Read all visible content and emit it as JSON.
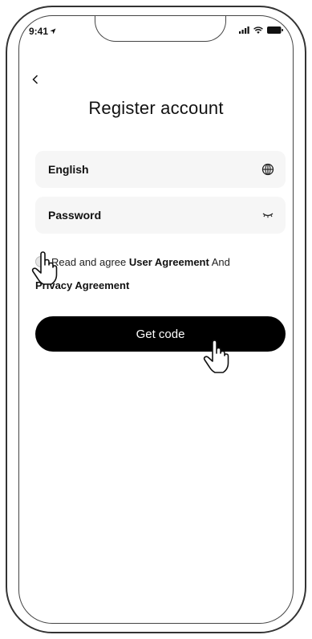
{
  "status_bar": {
    "time": "9:41",
    "icons": [
      "location-arrow-icon",
      "signal-icon",
      "wifi-icon",
      "battery-icon"
    ]
  },
  "header": {
    "back_icon": "chevron-left-icon",
    "title": "Register account"
  },
  "form": {
    "language_field": {
      "value": "English",
      "icon": "globe-icon"
    },
    "password_field": {
      "value": "Password",
      "icon": "eye-closed-icon"
    },
    "agreement": {
      "checked": false,
      "prefix": "Read and agree",
      "user_agreement": "User Agreement",
      "conjunction": "And",
      "privacy_agreement": "Privacy Agreement"
    },
    "submit_label": "Get code"
  },
  "annotations": [
    "hand-pointer-icon",
    "hand-pointer-icon"
  ],
  "colors": {
    "primary": "#000000",
    "field_bg": "#f6f6f6",
    "text": "#111111"
  }
}
